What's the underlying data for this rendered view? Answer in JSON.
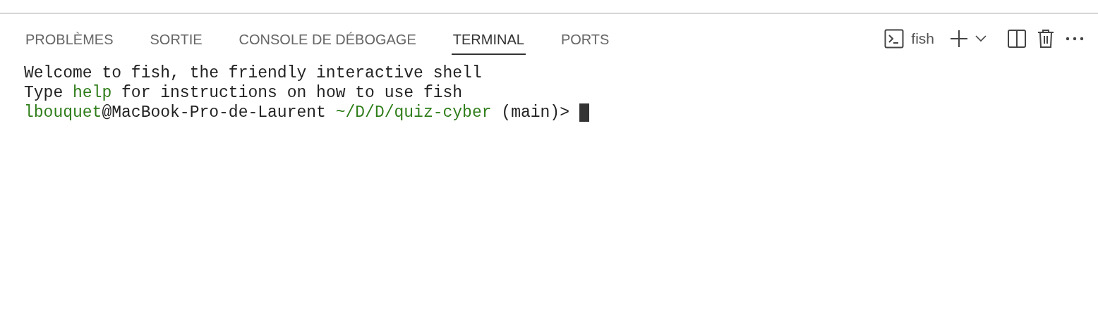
{
  "tabs": [
    {
      "label": "PROBLÈMES",
      "selected": false
    },
    {
      "label": "SORTIE",
      "selected": false
    },
    {
      "label": "CONSOLE DE DÉBOGAGE",
      "selected": false
    },
    {
      "label": "TERMINAL",
      "selected": true
    },
    {
      "label": "PORTS",
      "selected": false
    }
  ],
  "toolbar": {
    "shell_name": "fish"
  },
  "terminal": {
    "lines": [
      [
        {
          "text": "Welcome to fish, the friendly interactive shell",
          "kind": "plain"
        }
      ],
      [
        {
          "text": "Type ",
          "kind": "plain"
        },
        {
          "text": "help",
          "kind": "green"
        },
        {
          "text": " for instructions on how to use fish",
          "kind": "plain"
        }
      ],
      [
        {
          "text": "lbouquet",
          "kind": "green"
        },
        {
          "text": "@MacBook-Pro-de-Laurent ",
          "kind": "plain"
        },
        {
          "text": "~/D/D/quiz-cyber",
          "kind": "green"
        },
        {
          "text": " (main)> ",
          "kind": "plain"
        }
      ]
    ],
    "cursor": true
  }
}
